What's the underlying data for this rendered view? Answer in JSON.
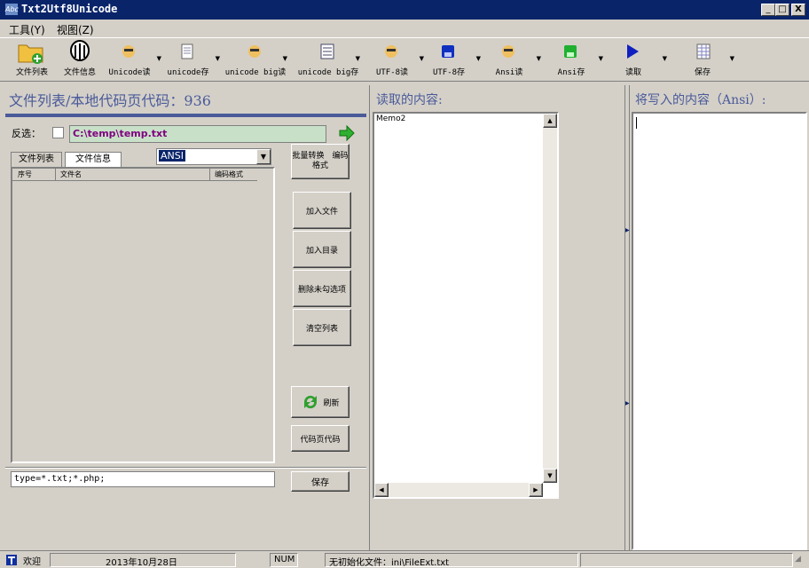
{
  "window": {
    "title": "Txt2Utf8Unicode",
    "icon_text": "Abc",
    "min": "_",
    "max": "□",
    "close": "X"
  },
  "menu": [
    "工具(Y)",
    "视图(Z)"
  ],
  "toolbar": [
    {
      "label": "文件列表",
      "icon": "folder-add-icon"
    },
    {
      "label": "文件信息",
      "icon": "info-icon"
    },
    {
      "label": "Unicode读",
      "icon": "face-read-icon"
    },
    {
      "label": "unicode存",
      "icon": "doc-icon"
    },
    {
      "label": "unicode big读",
      "icon": "face-read-icon"
    },
    {
      "label": "unicode big存",
      "icon": "list-icon"
    },
    {
      "label": "UTF-8读",
      "icon": "face-read-icon"
    },
    {
      "label": "UTF-8存",
      "icon": "blue-save-icon"
    },
    {
      "label": "Ansi读",
      "icon": "face-read-icon"
    },
    {
      "label": "Ansi存",
      "icon": "green-save-icon"
    },
    {
      "label": "读取",
      "icon": "play-icon"
    },
    {
      "label": "保存",
      "icon": "grid-icon"
    }
  ],
  "left": {
    "title": "文件列表/本地代码页代码：936",
    "select_label": "反选：",
    "path": "C:\\temp\\temp.txt",
    "tabs": [
      "文件列表",
      "文件信息"
    ],
    "encoding": "ANSI",
    "columns": [
      "序号",
      "文件名",
      "编码格式"
    ],
    "buttons": [
      "批量转换　编码格式",
      "加入文件",
      "加入目录",
      "删除未勾选项",
      "清空列表",
      "刷新",
      "代码页代码"
    ],
    "filter": "type=*.txt;*.php;",
    "save": "保存"
  },
  "middle": {
    "title": "读取的内容:",
    "memo": "Memo2"
  },
  "right": {
    "title": "将写入的内容（Ansi）:"
  },
  "status": {
    "welcome": "欢迎",
    "date": "2013年10月28日",
    "num": "NUM",
    "message": "无初始化文件：ini\\FileExt.txt"
  },
  "colors": {
    "titlebar": "#0a246a",
    "accent": "#4a5a9a",
    "path_bg": "#c8e0c8",
    "path_text": "#800080"
  }
}
